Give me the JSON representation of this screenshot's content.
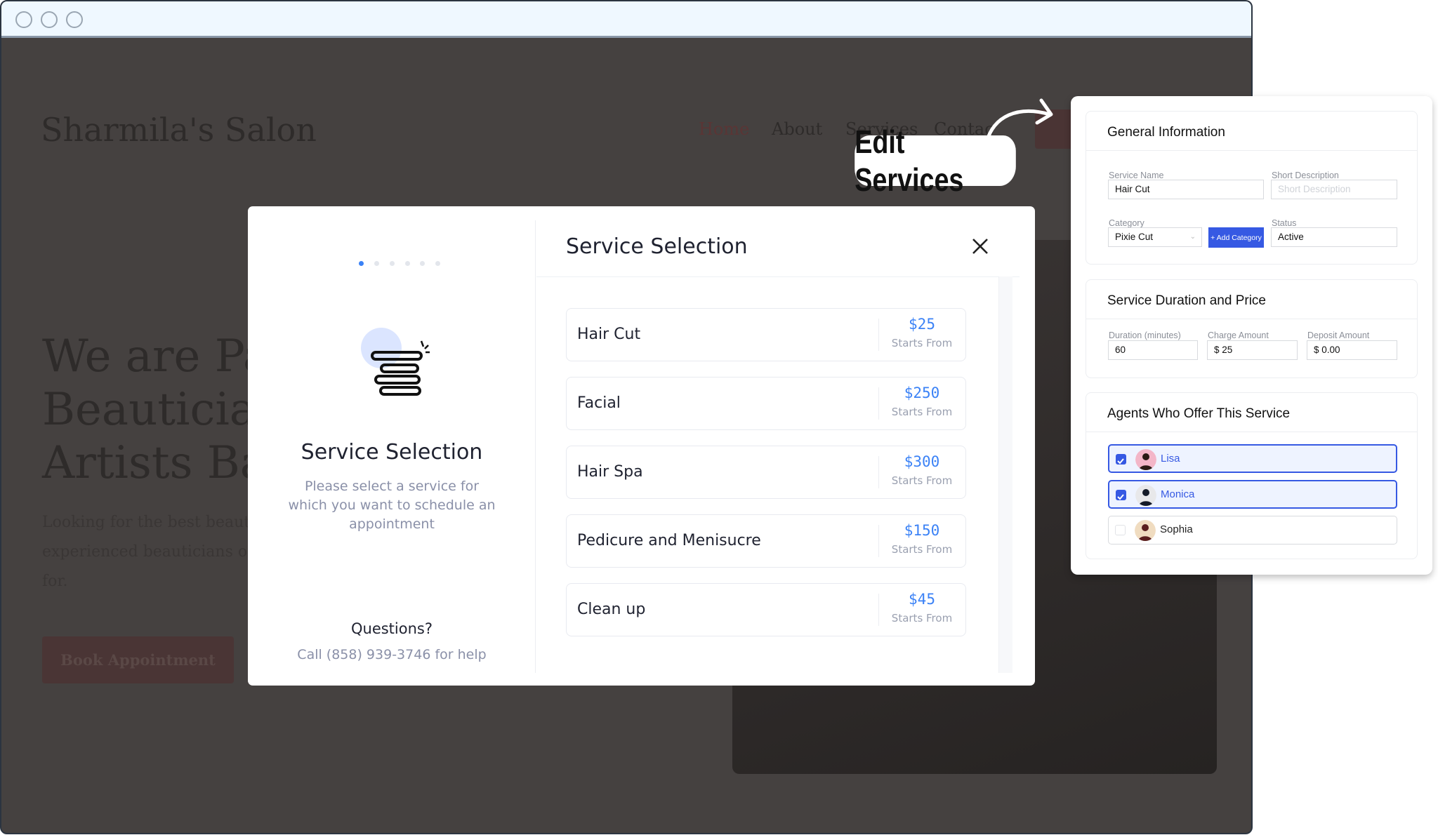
{
  "site": {
    "logo": "Sharmila's Salon",
    "nav": [
      "Home",
      "About",
      "Services",
      "Contac"
    ],
    "hero_lines": [
      "We are Pas",
      "Beautician",
      "Artists Bas"
    ],
    "para_lines": [
      "Looking for the best beauty a",
      "experienced beauticians offer",
      "for."
    ],
    "book_label": "Book Appointment"
  },
  "modal": {
    "step_count": 6,
    "active_step": 1,
    "left_title": "Service Selection",
    "left_desc": "Please select a service for which you want to schedule an appointment",
    "questions": "Questions?",
    "help": "Call (858) 939-3746 for help",
    "title": "Service Selection",
    "services": [
      {
        "name": "Hair Cut",
        "price": "$25",
        "note": "Starts From"
      },
      {
        "name": "Facial",
        "price": "$250",
        "note": "Starts From"
      },
      {
        "name": "Hair Spa",
        "price": "$300",
        "note": "Starts From"
      },
      {
        "name": "Pedicure and Menisucre",
        "price": "$150",
        "note": "Starts From"
      },
      {
        "name": "Clean up",
        "price": "$45",
        "note": "Starts From"
      }
    ]
  },
  "callout": "Edit Services",
  "panel": {
    "general": {
      "title": "General Information",
      "service_name_label": "Service Name",
      "service_name": "Hair Cut",
      "short_desc_label": "Short Description",
      "short_desc_placeholder": "Short Description",
      "category_label": "Category",
      "category": "Pixie Cut",
      "add_category": "+ Add Category",
      "status_label": "Status",
      "status": "Active"
    },
    "duration": {
      "title": "Service Duration and Price",
      "duration_label": "Duration (minutes)",
      "duration": "60",
      "charge_label": "Charge Amount",
      "charge": "$ 25",
      "deposit_label": "Deposit Amount",
      "deposit": "$ 0.00"
    },
    "agents": {
      "title": "Agents Who Offer This Service",
      "list": [
        {
          "name": "Lisa",
          "checked": true
        },
        {
          "name": "Monica",
          "checked": true
        },
        {
          "name": "Sophia",
          "checked": false
        }
      ]
    }
  },
  "colors": {
    "accent": "#3659e3",
    "price": "#3b82f6",
    "overlay": "#454140"
  }
}
